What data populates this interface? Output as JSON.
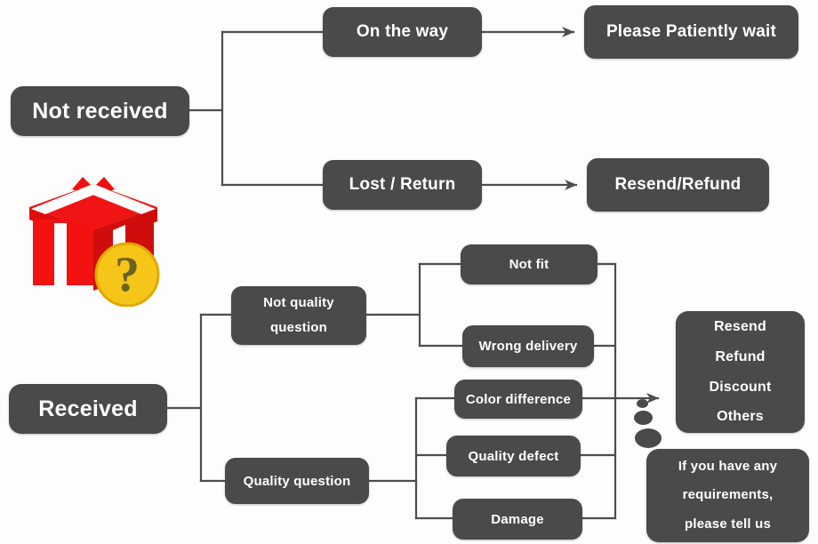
{
  "diagram": {
    "title": "Order issue handling flowchart",
    "colors": {
      "node_fill": "#4a4a4a",
      "node_text": "#ffffff",
      "wire": "#4d4d4d",
      "background": "#fdfdfd",
      "gift_red": "#ee1111",
      "gift_ribbon": "#ffffff",
      "badge_yellow": "#f5c518",
      "badge_mark": "#6b6320"
    },
    "icons": {
      "gift_box": "gift-box-icon",
      "question_badge": "question-mark-badge-icon"
    },
    "nodes": {
      "not_received": "Not received",
      "on_the_way": "On the way",
      "please_wait": "Please Patiently wait",
      "lost_return": "Lost / Return",
      "resend_refund": "Resend/Refund",
      "received": "Received",
      "not_quality_question_line1": "Not quality",
      "not_quality_question_line2": "question",
      "quality_question": "Quality question",
      "not_fit": "Not fit",
      "wrong_delivery": "Wrong delivery",
      "color_difference": "Color difference",
      "quality_defect": "Quality defect",
      "damage": "Damage",
      "outcome_line1": "Resend",
      "outcome_line2": "Refund",
      "outcome_line3": "Discount",
      "outcome_line4": "Others",
      "note_line1": "If you have any",
      "note_line2": "requirements,",
      "note_line3": "please tell us"
    }
  }
}
